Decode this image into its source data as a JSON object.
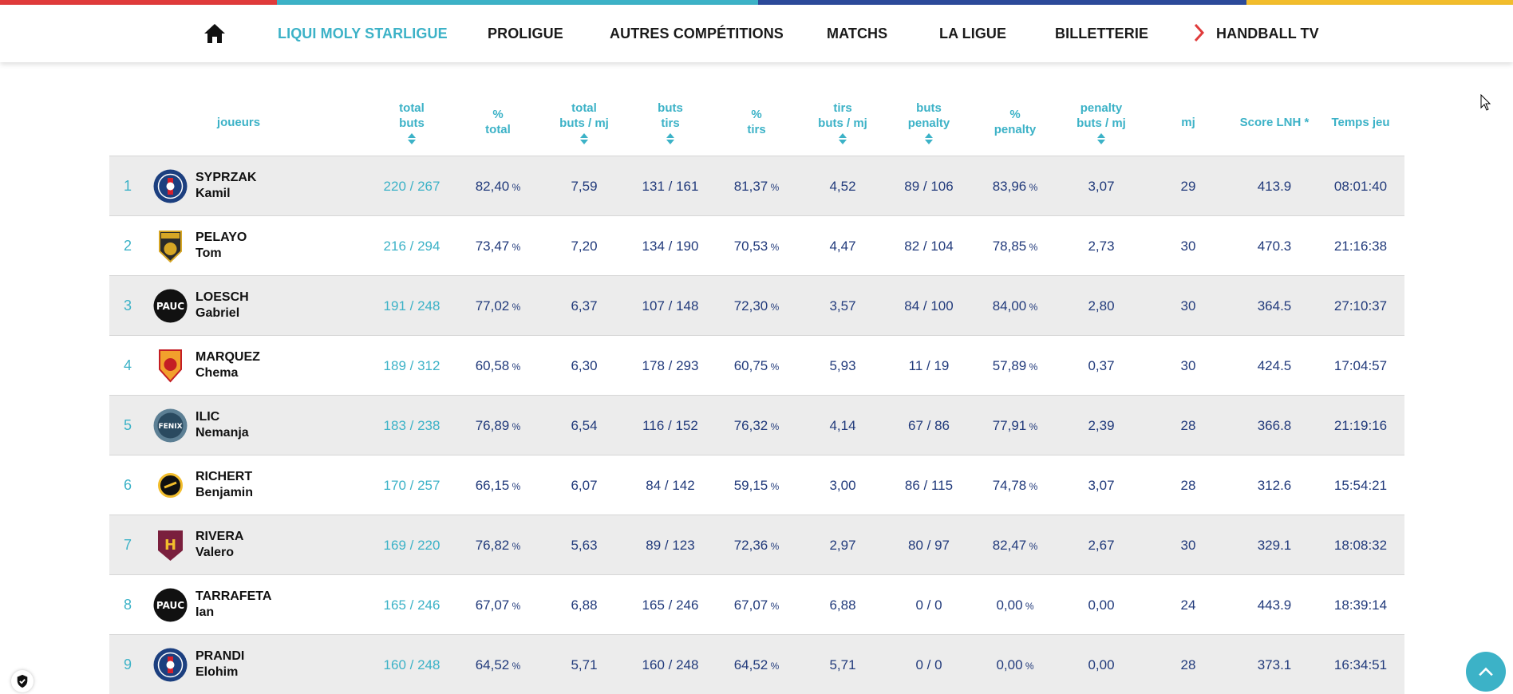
{
  "stripe_colors": [
    "#e03b3b",
    "#3cb2c7",
    "#2c4a9a",
    "#f2bd2c"
  ],
  "nav": {
    "home_icon": "home-icon",
    "items": [
      {
        "label": "LIQUI MOLY STARLIGUE",
        "active": true
      },
      {
        "label": "PROLIGUE"
      },
      {
        "label": "AUTRES COMPÉTITIONS"
      },
      {
        "label": "MATCHS"
      },
      {
        "label": "LA LIGUE"
      },
      {
        "label": "BILLETTERIE"
      },
      {
        "label": "HANDBALL TV",
        "icon": "chevron-right-icon"
      }
    ]
  },
  "table": {
    "headers": {
      "player": "joueurs",
      "total_goals": [
        "total",
        "buts"
      ],
      "pct_total": [
        "%",
        "total"
      ],
      "goals_per_match": [
        "total",
        "buts / mj"
      ],
      "shot_goals": [
        "buts",
        "tirs"
      ],
      "pct_shots": [
        "%",
        "tirs"
      ],
      "shots_per_match": [
        "tirs",
        "buts / mj"
      ],
      "penalty_goals": [
        "buts",
        "penalty"
      ],
      "pct_penalty": [
        "%",
        "penalty"
      ],
      "penalty_per_match": [
        "penalty",
        "buts / mj"
      ],
      "matches": "mj",
      "score": "Score LNH *",
      "time": "Temps jeu"
    },
    "rows": [
      {
        "rank": "1",
        "last": "SYPRZAK",
        "first": "Kamil",
        "club": "psg",
        "total": "220 / 267",
        "pct_total": "82,40",
        "gpm": "7,59",
        "shots": "131 / 161",
        "pct_shots": "81,37",
        "spm": "4,52",
        "pen": "89 / 106",
        "pct_pen": "83,96",
        "ppm": "3,07",
        "mj": "29",
        "score": "413.9",
        "time": "08:01:40"
      },
      {
        "rank": "2",
        "last": "PELAYO",
        "first": "Tom",
        "club": "usdk",
        "total": "216 / 294",
        "pct_total": "73,47",
        "gpm": "7,20",
        "shots": "134 / 190",
        "pct_shots": "70,53",
        "spm": "4,47",
        "pen": "82 / 104",
        "pct_pen": "78,85",
        "ppm": "2,73",
        "mj": "30",
        "score": "470.3",
        "time": "21:16:38"
      },
      {
        "rank": "3",
        "last": "LOESCH",
        "first": "Gabriel",
        "club": "pauc",
        "total": "191 / 248",
        "pct_total": "77,02",
        "gpm": "6,37",
        "shots": "107 / 148",
        "pct_shots": "72,30",
        "spm": "3,57",
        "pen": "84 / 100",
        "pct_pen": "84,00",
        "ppm": "2,80",
        "mj": "30",
        "score": "364.5",
        "time": "27:10:37"
      },
      {
        "rank": "4",
        "last": "MARQUEZ",
        "first": "Chema",
        "club": "sr",
        "total": "189 / 312",
        "pct_total": "60,58",
        "gpm": "6,30",
        "shots": "178 / 293",
        "pct_shots": "60,75",
        "spm": "5,93",
        "pen": "11 / 19",
        "pct_pen": "57,89",
        "ppm": "0,37",
        "mj": "30",
        "score": "424.5",
        "time": "17:04:57"
      },
      {
        "rank": "5",
        "last": "ILIC",
        "first": "Nemanja",
        "club": "fenix",
        "total": "183 / 238",
        "pct_total": "76,89",
        "gpm": "6,54",
        "shots": "116 / 152",
        "pct_shots": "76,32",
        "spm": "4,14",
        "pen": "67 / 86",
        "pct_pen": "77,91",
        "ppm": "2,39",
        "mj": "28",
        "score": "366.8",
        "time": "21:19:16"
      },
      {
        "rank": "6",
        "last": "RICHERT",
        "first": "Benjamin",
        "club": "chambery",
        "total": "170 / 257",
        "pct_total": "66,15",
        "gpm": "6,07",
        "shots": "84 / 142",
        "pct_shots": "59,15",
        "spm": "3,00",
        "pen": "86 / 115",
        "pct_pen": "74,78",
        "ppm": "3,07",
        "mj": "28",
        "score": "312.6",
        "time": "15:54:21"
      },
      {
        "rank": "7",
        "last": "RIVERA",
        "first": "Valero",
        "club": "nantes",
        "total": "169 / 220",
        "pct_total": "76,82",
        "gpm": "5,63",
        "shots": "89 / 123",
        "pct_shots": "72,36",
        "spm": "2,97",
        "pen": "80 / 97",
        "pct_pen": "82,47",
        "ppm": "2,67",
        "mj": "30",
        "score": "329.1",
        "time": "18:08:32"
      },
      {
        "rank": "8",
        "last": "TARRAFETA",
        "first": "Ian",
        "club": "pauc",
        "total": "165 / 246",
        "pct_total": "67,07",
        "gpm": "6,88",
        "shots": "165 / 246",
        "pct_shots": "67,07",
        "spm": "6,88",
        "pen": "0 / 0",
        "pct_pen": "0,00",
        "ppm": "0,00",
        "mj": "24",
        "score": "443.9",
        "time": "18:39:14"
      },
      {
        "rank": "9",
        "last": "PRANDI",
        "first": "Elohim",
        "club": "psg",
        "total": "160 / 248",
        "pct_total": "64,52",
        "gpm": "5,71",
        "shots": "160 / 248",
        "pct_shots": "64,52",
        "spm": "5,71",
        "pen": "0 / 0",
        "pct_pen": "0,00",
        "ppm": "0,00",
        "mj": "28",
        "score": "373.1",
        "time": "16:34:51"
      }
    ],
    "pct_symbol": "%"
  },
  "accent": "#3cb2c7",
  "text_color": "#213a7b"
}
